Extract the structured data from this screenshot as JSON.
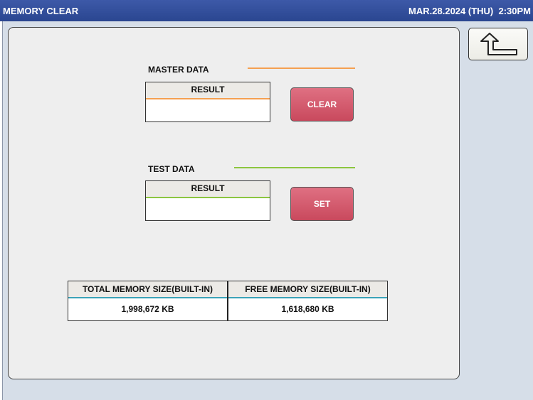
{
  "header": {
    "title": "MEMORY CLEAR",
    "datetime": "MAR.28.2024 (THU)  2:30PM"
  },
  "back_button": {
    "icon": "return-arrow-icon"
  },
  "master_data": {
    "label": "MASTER DATA",
    "result_header": "RESULT",
    "result_value": "",
    "button_label": "CLEAR",
    "accent_color": "#f5a050"
  },
  "test_data": {
    "label": "TEST DATA",
    "result_header": "RESULT",
    "result_value": "",
    "button_label": "SET",
    "accent_color": "#8cc63f"
  },
  "memory": {
    "total_label": "TOTAL MEMORY SIZE(BUILT-IN)",
    "total_value": "1,998,672 KB",
    "free_label": "FREE MEMORY SIZE(BUILT-IN)",
    "free_value": "1,618,680 KB"
  }
}
